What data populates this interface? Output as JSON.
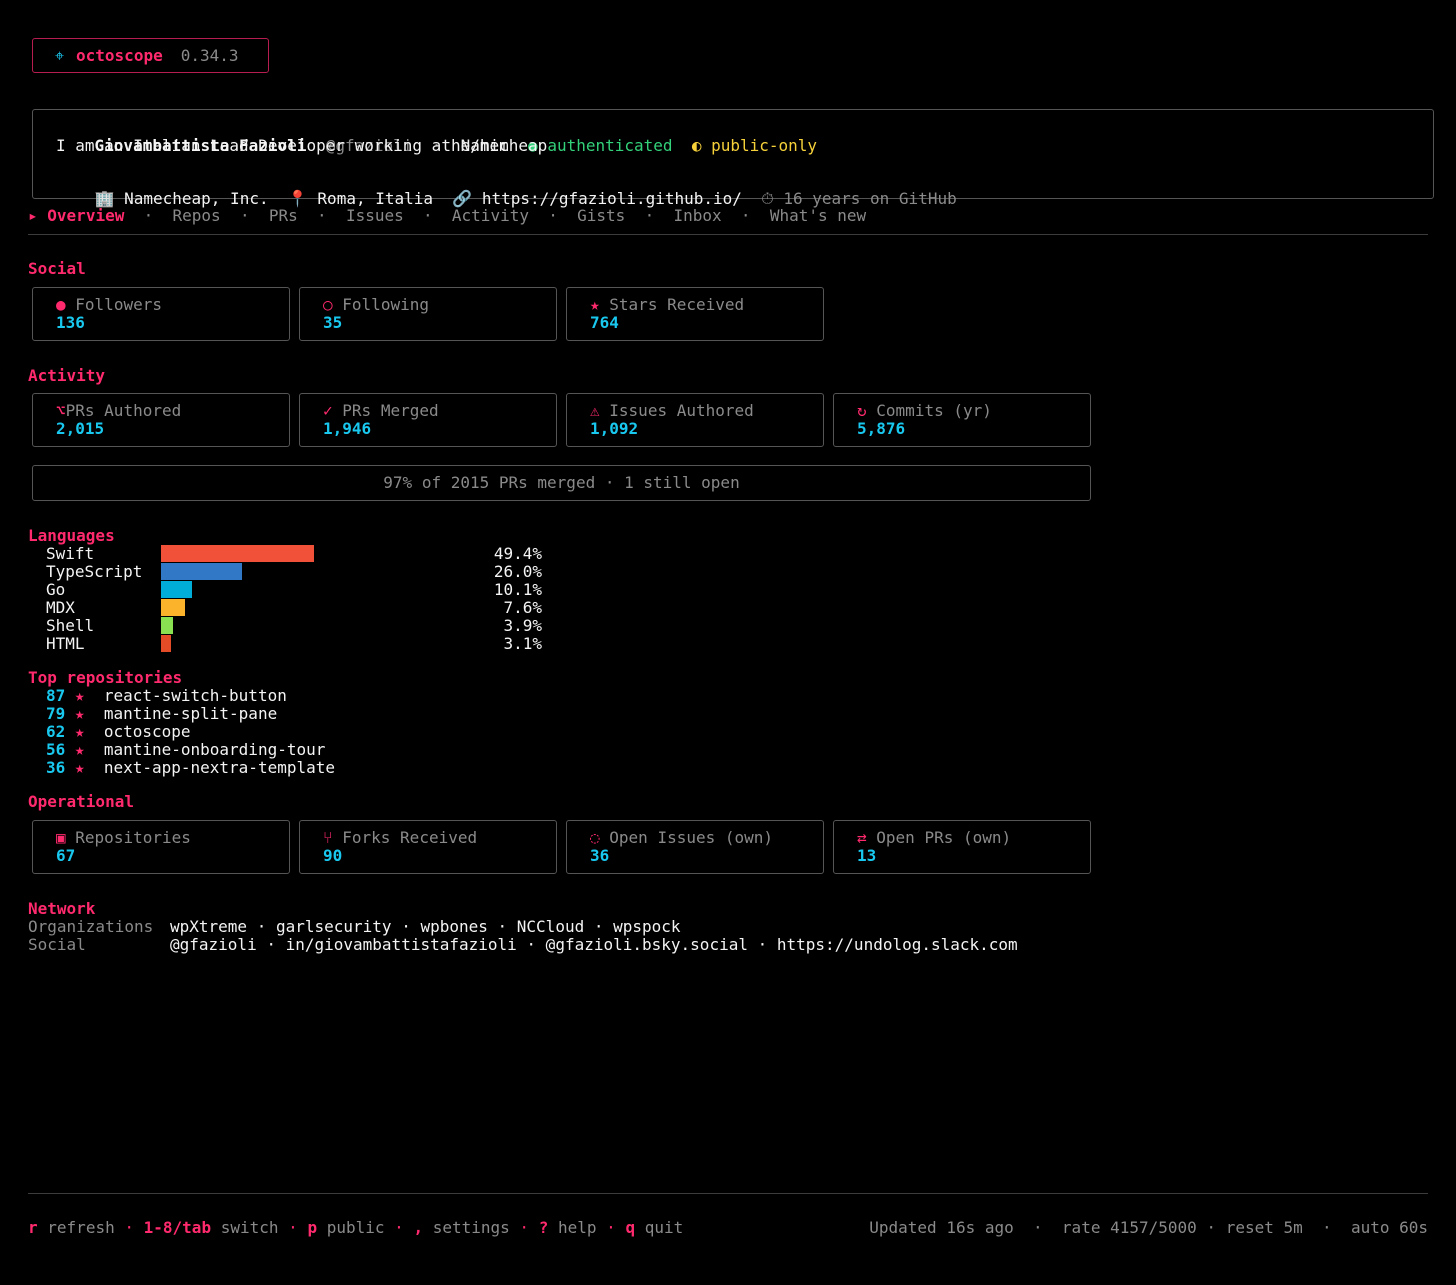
{
  "app": {
    "icon": "crosshair-icon",
    "icon_glyph": "⌖",
    "name": "octoscope",
    "version": "0.34.3"
  },
  "profile": {
    "name": "Giovambattista Fazioli",
    "handle": "@gfazioli",
    "sep": "·",
    "pronouns": "he/him",
    "auth_dot": "●",
    "auth": "authenticated",
    "scope_icon": "◐",
    "scope": "public-only",
    "bio": "I am an Italian Lead Developer working at Namecheap",
    "company_icon": "🏢",
    "company": "Namecheap, Inc.",
    "location_icon": "📍",
    "location": "Roma, Italia",
    "link_icon": "🔗",
    "link": "https://gfazioli.github.io/",
    "age_icon": "⏱",
    "age": "16 years on GitHub"
  },
  "tabs": {
    "active_marker": "▸",
    "sep": "·",
    "items": [
      "Overview",
      "Repos",
      "PRs",
      "Issues",
      "Activity",
      "Gists",
      "Inbox",
      "What's new"
    ]
  },
  "social": {
    "title": "Social",
    "cards": [
      {
        "icon": "●",
        "label": "Followers",
        "value": "136"
      },
      {
        "icon": "○",
        "label": "Following",
        "value": "35"
      },
      {
        "icon": "★",
        "label": "Stars Received",
        "value": "764"
      }
    ]
  },
  "activity": {
    "title": "Activity",
    "cards": [
      {
        "icon": "⌥",
        "label": "PRs Authored",
        "value": "2,015"
      },
      {
        "icon": "✓",
        "label": "PRs Merged",
        "value": "1,946"
      },
      {
        "icon": "⚠",
        "label": "Issues Authored",
        "value": "1,092"
      },
      {
        "icon": "↻",
        "label": "Commits (yr)",
        "value": "5,876"
      }
    ],
    "merge_summary": "97% of 2015 PRs merged · 1 still open"
  },
  "languages": {
    "title": "Languages",
    "items": [
      {
        "name": "Swift",
        "percent": 49.4,
        "label": "49.4%",
        "color": "#f05138"
      },
      {
        "name": "TypeScript",
        "percent": 26.0,
        "label": "26.0%",
        "color": "#3178c6"
      },
      {
        "name": "Go",
        "percent": 10.1,
        "label": "10.1%",
        "color": "#00add8"
      },
      {
        "name": "MDX",
        "percent": 7.6,
        "label": "7.6%",
        "color": "#fcb32c"
      },
      {
        "name": "Shell",
        "percent": 3.9,
        "label": "3.9%",
        "color": "#89e051"
      },
      {
        "name": "HTML",
        "percent": 3.1,
        "label": "3.1%",
        "color": "#e34c26"
      }
    ]
  },
  "top_repos": {
    "title": "Top repositories",
    "star": "★",
    "items": [
      {
        "stars": "87",
        "name": "react-switch-button"
      },
      {
        "stars": "79",
        "name": "mantine-split-pane"
      },
      {
        "stars": "62",
        "name": "octoscope"
      },
      {
        "stars": "56",
        "name": "mantine-onboarding-tour"
      },
      {
        "stars": "36",
        "name": "next-app-nextra-template"
      }
    ]
  },
  "operational": {
    "title": "Operational",
    "cards": [
      {
        "icon": "▣",
        "label": "Repositories",
        "value": "67"
      },
      {
        "icon": "⑂",
        "label": "Forks Received",
        "value": "90"
      },
      {
        "icon": "◌",
        "label": "Open Issues (own)",
        "value": "36"
      },
      {
        "icon": "⇄",
        "label": "Open PRs (own)",
        "value": "13"
      }
    ]
  },
  "network": {
    "title": "Network",
    "org_label": "Organizations",
    "orgs": "wpXtreme · garlsecurity · wpbones · NCCloud · wpspock",
    "social_label": "Social",
    "social": "@gfazioli · in/giovambattistafazioli · @gfazioli.bsky.social · https://undolog.slack.com"
  },
  "footer": {
    "sep": "·",
    "keys": [
      {
        "key": "r",
        "action": "refresh"
      },
      {
        "key": "1-8/tab",
        "action": "switch"
      },
      {
        "key": "p",
        "action": "public"
      },
      {
        "key": ",",
        "action": "settings"
      },
      {
        "key": "?",
        "action": "help"
      },
      {
        "key": "q",
        "action": "quit"
      }
    ],
    "updated": "Updated 16s ago",
    "rate": "rate 4157/5000",
    "reset": "reset 5m",
    "auto": "auto 60s"
  }
}
